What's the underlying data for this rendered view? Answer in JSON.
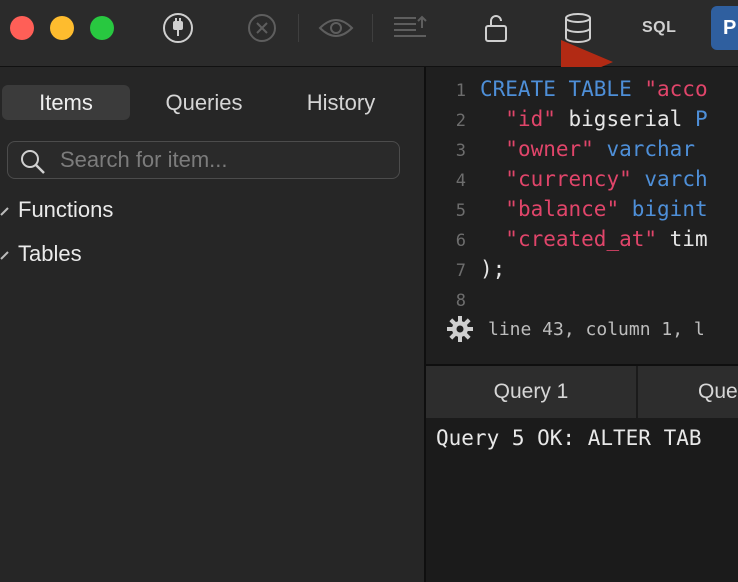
{
  "toolbar": {
    "sql_label": "SQL",
    "pg_badge": "P",
    "icons": [
      "plug-icon",
      "close-circle-icon",
      "eye-icon",
      "upload-text-icon",
      "lock-open-icon",
      "database-icon",
      "run-icon"
    ]
  },
  "sidebar": {
    "tabs": [
      {
        "label": "Items",
        "active": true
      },
      {
        "label": "Queries",
        "active": false
      },
      {
        "label": "History",
        "active": false
      }
    ],
    "search": {
      "placeholder": "Search for item...",
      "value": ""
    },
    "tree": [
      {
        "label": "Functions"
      },
      {
        "label": "Tables"
      }
    ]
  },
  "editor": {
    "lines": [
      {
        "n": "1",
        "tokens": [
          {
            "t": "CREATE TABLE ",
            "c": "kw"
          },
          {
            "t": "\"acco",
            "c": "str"
          }
        ]
      },
      {
        "n": "2",
        "tokens": [
          {
            "t": "  ",
            "c": "id"
          },
          {
            "t": "\"id\"",
            "c": "str"
          },
          {
            "t": " bigserial ",
            "c": "id"
          },
          {
            "t": "P",
            "c": "kw"
          }
        ]
      },
      {
        "n": "3",
        "tokens": [
          {
            "t": "  ",
            "c": "id"
          },
          {
            "t": "\"owner\"",
            "c": "str"
          },
          {
            "t": " ",
            "c": "id"
          },
          {
            "t": "varchar",
            "c": "kw"
          }
        ]
      },
      {
        "n": "4",
        "tokens": [
          {
            "t": "  ",
            "c": "id"
          },
          {
            "t": "\"currency\"",
            "c": "str"
          },
          {
            "t": " ",
            "c": "id"
          },
          {
            "t": "varch",
            "c": "kw"
          }
        ]
      },
      {
        "n": "5",
        "tokens": [
          {
            "t": "  ",
            "c": "id"
          },
          {
            "t": "\"balance\"",
            "c": "str"
          },
          {
            "t": " ",
            "c": "id"
          },
          {
            "t": "bigint",
            "c": "kw"
          }
        ]
      },
      {
        "n": "6",
        "tokens": [
          {
            "t": "  ",
            "c": "id"
          },
          {
            "t": "\"created_at\"",
            "c": "str"
          },
          {
            "t": " tim",
            "c": "id"
          }
        ]
      },
      {
        "n": "7",
        "tokens": [
          {
            "t": ");",
            "c": "id"
          }
        ]
      },
      {
        "n": "8",
        "tokens": []
      }
    ],
    "status": "line 43, column 1, l"
  },
  "query_tabs": [
    "Query 1",
    "Que"
  ],
  "result": {
    "text": "Query 5 OK: ALTER TAB"
  },
  "colors": {
    "accent": "#2f5f9f",
    "keyword": "#4e8fd8",
    "string": "#e0456a",
    "run": "#b22a14"
  }
}
